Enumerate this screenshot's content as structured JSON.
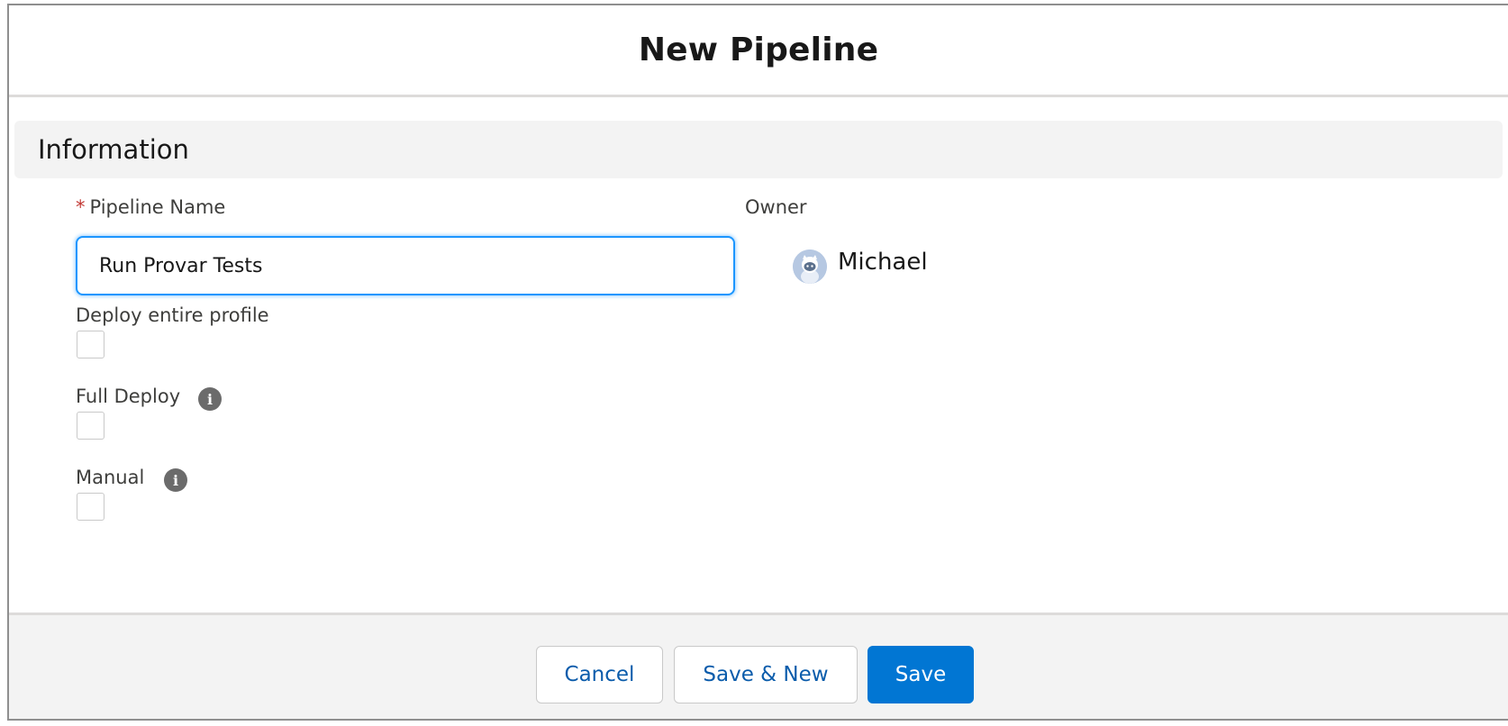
{
  "modal": {
    "title": "New Pipeline"
  },
  "section": {
    "title": "Information"
  },
  "fields": {
    "pipeline_name": {
      "required_mark": "*",
      "label": "Pipeline Name",
      "value": "Run Provar Tests"
    },
    "owner": {
      "label": "Owner",
      "name": "Michael",
      "avatar_icon": "user-avatar-icon"
    },
    "deploy_entire_profile": {
      "label": "Deploy entire profile",
      "checked": false
    },
    "full_deploy": {
      "label": "Full Deploy",
      "checked": false,
      "help_icon": "info-icon",
      "help_glyph": "i"
    },
    "manual": {
      "label": "Manual",
      "checked": false,
      "help_icon": "info-icon",
      "help_glyph": "i"
    }
  },
  "footer": {
    "cancel_label": "Cancel",
    "save_new_label": "Save & New",
    "save_label": "Save"
  },
  "colors": {
    "brand": "#0176d3",
    "link_text": "#0b5cab",
    "focus_ring": "#1b96ff",
    "required": "#c23934",
    "section_bg": "#f3f3f3"
  }
}
